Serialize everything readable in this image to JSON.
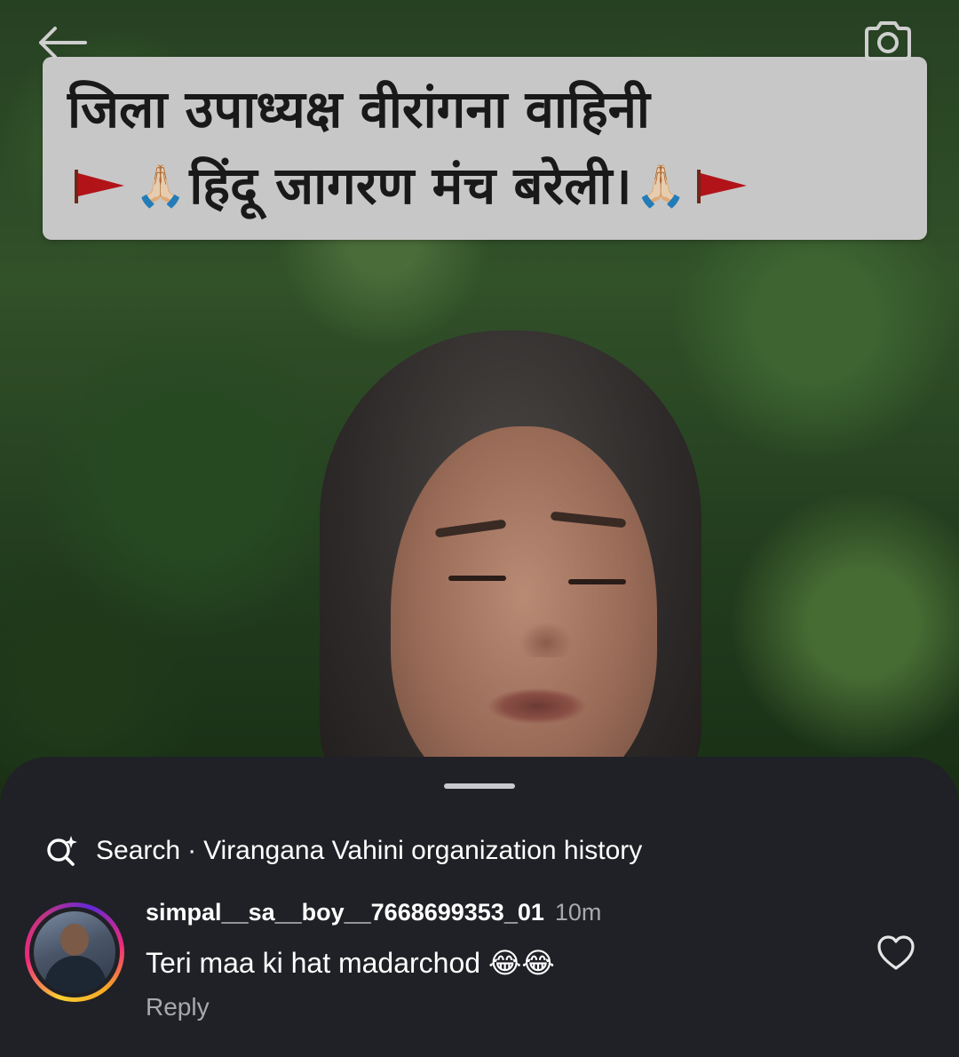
{
  "video": {
    "sticker": {
      "line1": "जिला उपाध्यक्ष वीरांगना वाहिनी",
      "line2": "हिंदू जागरण मंच बरेली।",
      "emoji_pray": "🙏🏻"
    }
  },
  "icons": {
    "back": "back-arrow-icon",
    "camera": "camera-icon",
    "search": "ai-search-icon",
    "like": "heart-outline-icon"
  },
  "sheet": {
    "search": {
      "label": "Search",
      "separator": "·",
      "query": "Virangana Vahini organization history"
    },
    "comment": {
      "username": "simpal__sa__boy__7668699353_01",
      "time": "10m",
      "text": "Teri maa ki hat madarchod 😂😂",
      "reply_label": "Reply"
    }
  },
  "colors": {
    "sheet_bg": "#202126",
    "text_primary": "#ffffff",
    "text_secondary": "#a8a9ae",
    "flag_red": "#c0151b",
    "sticker_bg": "#d7d7d7"
  }
}
